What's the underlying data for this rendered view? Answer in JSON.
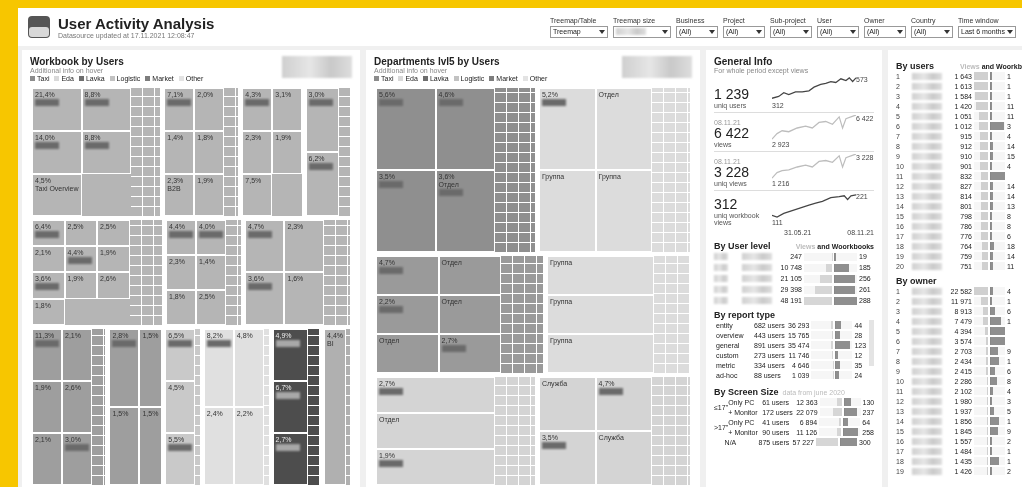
{
  "header": {
    "title": "User Activity Analysis",
    "subtitle": "Datasource updated at 17.11.2021 12:08:47",
    "filters": [
      {
        "label": "Treemap/Table",
        "value": "Treemap"
      },
      {
        "label": "Treemap size",
        "redacted": true
      },
      {
        "label": "Business",
        "value": "(All)"
      },
      {
        "label": "Project",
        "value": "(All)"
      },
      {
        "label": "Sub-project",
        "value": "(All)"
      },
      {
        "label": "User",
        "value": "(All)"
      },
      {
        "label": "Owner",
        "value": "(All)"
      },
      {
        "label": "Country",
        "value": "(All)"
      },
      {
        "label": "Time window",
        "value": "Last 6 months"
      }
    ]
  },
  "treemaps": [
    {
      "title": "Workbook by Users",
      "subtitle": "Additional info on hover",
      "legend": [
        {
          "label": "Taxi",
          "color": "#8c8c8c"
        },
        {
          "label": "Eda",
          "color": "#d9d9d9"
        },
        {
          "label": "Lavka",
          "color": "#6e6e6e"
        },
        {
          "label": "Logistic",
          "color": "#c2c2c2"
        },
        {
          "label": "Market",
          "color": "#7d7d7d"
        },
        {
          "label": "Other",
          "color": "#e3e3e3"
        }
      ],
      "bands": [
        {
          "groups": [
            {
              "color": "#b5b5b5",
              "tiles": [
                {
                  "value": "21,4%",
                  "redacted": true
                },
                {
                  "value": "8,8%",
                  "redacted": true
                },
                {
                  "value": "14,0%",
                  "redacted": true
                },
                {
                  "value": "8,8%",
                  "redacted": true
                },
                {
                  "value": "4,5%",
                  "name": "Taxi Overview"
                }
              ]
            },
            {
              "color": "#b5b5b5",
              "tiles": [
                {
                  "value": "7,1%",
                  "redacted": true
                },
                {
                  "value": "2,0%"
                },
                {
                  "value": "1,4%"
                },
                {
                  "value": "1,8%"
                },
                {
                  "value": "2,3%",
                  "name": "B2B"
                },
                {
                  "value": "1,9%"
                }
              ]
            },
            {
              "color": "#b5b5b5",
              "tiles": [
                {
                  "value": "4,3%",
                  "redacted": true
                },
                {
                  "value": "3,1%"
                },
                {
                  "value": "2,3%"
                },
                {
                  "value": "1,9%"
                },
                {
                  "value": "7,5%"
                }
              ]
            },
            {
              "color": "#b5b5b5",
              "tiles": [
                {
                  "value": "3,0%",
                  "redacted": true
                },
                {
                  "value": "6,2%",
                  "redacted": true
                }
              ]
            }
          ]
        },
        {
          "groups": [
            {
              "color": "#b5b5b5",
              "tiles": [
                {
                  "value": "6,4%",
                  "redacted": true
                },
                {
                  "value": "2,5%"
                },
                {
                  "value": "2,5%"
                },
                {
                  "value": "2,1%"
                },
                {
                  "value": "4,4%",
                  "redacted": true
                },
                {
                  "value": "1,9%"
                },
                {
                  "value": "3,6%",
                  "redacted": true
                },
                {
                  "value": "1,9%"
                },
                {
                  "value": "2,6%"
                },
                {
                  "value": "1,8%"
                }
              ]
            },
            {
              "color": "#b5b5b5",
              "tiles": [
                {
                  "value": "4,4%",
                  "redacted": true
                },
                {
                  "value": "4,0%",
                  "redacted": true
                },
                {
                  "value": "2,3%"
                },
                {
                  "value": "1,4%"
                },
                {
                  "value": "1,8%"
                },
                {
                  "value": "2,5%"
                }
              ]
            },
            {
              "color": "#b5b5b5",
              "tiles": [
                {
                  "value": "4,7%",
                  "redacted": true
                },
                {
                  "value": "2,3%"
                },
                {
                  "value": "3,6%",
                  "redacted": true
                },
                {
                  "value": "1,6%"
                }
              ]
            }
          ]
        },
        {
          "groups": [
            {
              "color": "#9e9e9e",
              "tiles": [
                {
                  "value": "11,3%",
                  "redacted": true
                },
                {
                  "value": "2,1%"
                },
                {
                  "value": "1,9%"
                },
                {
                  "value": "2,6%"
                },
                {
                  "value": "2,1%"
                },
                {
                  "value": "3,0%",
                  "redacted": true
                }
              ]
            },
            {
              "color": "#9e9e9e",
              "tiles": [
                {
                  "value": "2,8%",
                  "redacted": true
                },
                {
                  "value": "1,5%"
                },
                {
                  "value": "1,5%"
                },
                {
                  "value": "1,5%"
                }
              ]
            },
            {
              "color": "#c9c9c9",
              "tiles": [
                {
                  "value": "6,5%",
                  "redacted": true
                },
                {
                  "value": "4,5%"
                },
                {
                  "value": "5,5%",
                  "redacted": true
                }
              ]
            },
            {
              "color": "#e0e0e0",
              "tiles": [
                {
                  "value": "8,2%",
                  "redacted": true
                },
                {
                  "value": "4,8%"
                },
                {
                  "value": "2,4%"
                },
                {
                  "value": "2,2%"
                }
              ]
            },
            {
              "color": "#4d4d4d",
              "tiles": [
                {
                  "value": "4,9%",
                  "redacted": true
                },
                {
                  "value": "6,7%",
                  "redacted": true
                },
                {
                  "value": "2,7%",
                  "redacted": true
                }
              ]
            },
            {
              "color": "#b0b0b0",
              "tiles": [
                {
                  "value": "4,4%",
                  "name": "BI"
                }
              ]
            }
          ]
        }
      ]
    },
    {
      "title": "Departments lvl5 by Users",
      "subtitle": "Additional info on hover",
      "legend": [
        {
          "label": "Taxi",
          "color": "#8c8c8c"
        },
        {
          "label": "Eda",
          "color": "#d9d9d9"
        },
        {
          "label": "Lavka",
          "color": "#6e6e6e"
        },
        {
          "label": "Logistic",
          "color": "#c2c2c2"
        },
        {
          "label": "Market",
          "color": "#7d7d7d"
        },
        {
          "label": "Other",
          "color": "#e3e3e3"
        }
      ],
      "bands": [
        {
          "groups": [
            {
              "color": "#8f8f8f",
              "tiles": [
                {
                  "value": "5,6%",
                  "redacted": true
                },
                {
                  "value": "4,6%",
                  "redacted": true
                },
                {
                  "value": "3,5%",
                  "redacted": true
                },
                {
                  "value": "3,6%",
                  "name": "Отдел",
                  "redacted": true
                }
              ]
            },
            {
              "color": "#dcdcdc",
              "tiles": [
                {
                  "value": "5,2%",
                  "redacted": true
                },
                {
                  "name": "Отдел"
                },
                {
                  "name": "Группа"
                },
                {
                  "name": "Группа"
                }
              ]
            }
          ]
        },
        {
          "groups": [
            {
              "color": "#9a9a9a",
              "tiles": [
                {
                  "value": "4,7%",
                  "redacted": true
                },
                {
                  "name": "Отдел"
                },
                {
                  "value": "2,2%",
                  "redacted": true
                },
                {
                  "name": "Отдел"
                },
                {
                  "name": "Отдел"
                },
                {
                  "value": "2,7%",
                  "redacted": true
                }
              ]
            },
            {
              "color": "#dcdcdc",
              "tiles": [
                {
                  "name": "Группа"
                },
                {
                  "name": "Группа"
                },
                {
                  "name": "Группа"
                }
              ]
            }
          ]
        },
        {
          "groups": [
            {
              "color": "#d4d4d4",
              "tiles": [
                {
                  "value": "2,7%",
                  "redacted": true
                },
                {
                  "name": "Отдел"
                },
                {
                  "value": "1,9%",
                  "redacted": true
                }
              ]
            },
            {
              "color": "#d4d4d4",
              "tiles": [
                {
                  "name": "Служба"
                },
                {
                  "value": "4,7%",
                  "redacted": true
                },
                {
                  "value": "3,5%",
                  "redacted": true
                },
                {
                  "name": "Служба"
                }
              ]
            }
          ]
        }
      ]
    }
  ],
  "general_info": {
    "title": "General Info",
    "subtitle": "For whole period except views",
    "metrics": [
      {
        "value": "1 239",
        "label": "uniq users",
        "start": "312",
        "end": "573",
        "color": "#444444"
      },
      {
        "date": "08.11.21",
        "value": "6 422",
        "label": "views",
        "start": "2 923",
        "end": "6 422",
        "color": "#bdbdbd"
      },
      {
        "date": "08.11.21",
        "value": "3 228",
        "label": "uniq views",
        "start": "1 216",
        "end": "3 228",
        "color": "#bdbdbd"
      },
      {
        "value": "312",
        "label": "uniq workbook views",
        "start": "111",
        "end": "221",
        "color": "#444444"
      }
    ],
    "axis": [
      "31.05.21",
      "08.11.21"
    ]
  },
  "user_level": {
    "title": "By User level",
    "header_views": "Views",
    "header_rest": "and Woorkbooks",
    "rows": [
      {
        "views": "247",
        "views_bar": {
          "level": 0.01
        },
        "workbooks": "19",
        "workbooks_bar": {
          "level": 0.02
        }
      },
      {
        "views": "10 748",
        "views_bar": {
          "level": 0.22
        },
        "workbooks": "185",
        "workbooks_bar": {
          "level": 0.64
        }
      },
      {
        "views": "21 105",
        "views_bar": {
          "level": 0.44
        },
        "workbooks": "256",
        "workbooks_bar": {
          "level": 0.89
        }
      },
      {
        "views": "29 398",
        "views_bar": {
          "level": 0.61
        },
        "workbooks": "261",
        "workbooks_bar": {
          "level": 0.91
        }
      },
      {
        "views": "48 191",
        "views_bar": {
          "level": 1
        },
        "workbooks": "288",
        "workbooks_bar": {
          "level": 1
        }
      }
    ]
  },
  "report_type": {
    "title": "By report type",
    "rows": [
      {
        "type": "entity",
        "users": "682 users",
        "views": "36 293",
        "views_bar": {
          "level": 0.12
        },
        "workbooks": "44",
        "workbooks_bar": {
          "level": 0.3
        }
      },
      {
        "type": "overview",
        "users": "443 users",
        "views": "15 765",
        "views_bar": {
          "level": 0.06
        },
        "workbooks": "28",
        "workbooks_bar": {
          "level": 0.2
        }
      },
      {
        "type": "general",
        "users": "891 users",
        "views": "35 474",
        "views_bar": {
          "level": 0.12
        },
        "workbooks": "123",
        "workbooks_bar": {
          "level": 0.85
        }
      },
      {
        "type": "custom",
        "users": "273 users",
        "views": "11 746",
        "views_bar": {
          "level": 0.05
        },
        "workbooks": "12",
        "workbooks_bar": {
          "level": 0.08
        }
      },
      {
        "type": "metric",
        "users": "334 users",
        "views": "4 646",
        "views_bar": {
          "level": 0.02
        },
        "workbooks": "35",
        "workbooks_bar": {
          "level": 0.24
        }
      },
      {
        "type": "ad-hoc",
        "users": "88 users",
        "views": "1 039",
        "views_bar": {
          "level": 0.01
        },
        "workbooks": "24",
        "workbooks_bar": {
          "level": 0.17
        }
      }
    ]
  },
  "screen_size": {
    "title": "By Screen Size",
    "note": "data from june 2020",
    "groups": [
      {
        "label": "≤17\"",
        "rows": [
          {
            "type": "Only PC",
            "users": "61 users",
            "views": "12 363",
            "views_bar": {
              "level": 0.2
            },
            "workbooks": "130",
            "workbooks_bar": {
              "level": 0.43
            }
          },
          {
            "type": "+ Monitor",
            "users": "172 users",
            "views": "22 079",
            "views_bar": {
              "level": 0.38
            },
            "workbooks": "237",
            "workbooks_bar": {
              "level": 0.79
            }
          }
        ]
      },
      {
        "label": ">17\"",
        "rows": [
          {
            "type": "Only PC",
            "users": "41 users",
            "views": "6 894",
            "views_bar": {
              "level": 0.12
            },
            "workbooks": "64",
            "workbooks_bar": {
              "level": 0.21
            }
          },
          {
            "type": "+ Monitor",
            "users": "90 users",
            "views": "11 126",
            "views_bar": {
              "level": 0.19
            },
            "workbooks": "258",
            "workbooks_bar": {
              "level": 0.86
            }
          }
        ]
      },
      {
        "rows": [
          {
            "type": "N/A",
            "users": "875 users",
            "views": "57 227",
            "views_bar": {
              "level": 1
            },
            "workbooks": "300",
            "workbooks_bar": {
              "level": 1
            }
          }
        ]
      }
    ]
  },
  "by_users": {
    "title": "By users",
    "header_views": "Views",
    "header_rest": "and Woorkb",
    "rows": [
      {
        "rank": "1",
        "views": "1 643",
        "views_bar": {
          "level": 1
        },
        "workbooks": "1",
        "workbooks_bar": {
          "level": 0.03
        }
      },
      {
        "rank": "2",
        "views": "1 613",
        "views_bar": {
          "level": 0.98
        },
        "workbooks": "1",
        "workbooks_bar": {
          "level": 0.03
        }
      },
      {
        "rank": "3",
        "views": "1 584",
        "views_bar": {
          "level": 0.96
        },
        "workbooks": "1",
        "workbooks_bar": {
          "level": 0.03
        }
      },
      {
        "rank": "4",
        "views": "1 420",
        "views_bar": {
          "level": 0.86
        },
        "workbooks": "11",
        "workbooks_bar": {
          "level": 0.1
        }
      },
      {
        "rank": "5",
        "views": "1 051",
        "views_bar": {
          "level": 0.64
        },
        "workbooks": "11",
        "workbooks_bar": {
          "level": 0.1
        }
      },
      {
        "rank": "6",
        "views": "1 012",
        "views_bar": {
          "level": 0.62
        },
        "workbooks": "3",
        "workbooks_bar": {
          "level": 0.9
        }
      },
      {
        "rank": "7",
        "views": "915",
        "views_bar": {
          "level": 0.56
        },
        "workbooks": "4",
        "workbooks_bar": {
          "level": 0.05
        }
      },
      {
        "rank": "8",
        "views": "912",
        "views_bar": {
          "level": 0.56
        },
        "workbooks": "14",
        "workbooks_bar": {
          "level": 0.15
        }
      },
      {
        "rank": "9",
        "views": "910",
        "views_bar": {
          "level": 0.55
        },
        "workbooks": "15",
        "workbooks_bar": {
          "level": 0.16
        }
      },
      {
        "rank": "10",
        "views": "901",
        "views_bar": {
          "level": 0.55
        },
        "workbooks": "4",
        "workbooks_bar": {
          "level": 0.05
        }
      },
      {
        "rank": "11",
        "views": "832",
        "views_bar": {
          "level": 0.51
        },
        "workbooks_bar": {
          "level": 1
        }
      },
      {
        "rank": "12",
        "views": "827",
        "views_bar": {
          "level": 0.5
        },
        "workbooks": "14",
        "workbooks_bar": {
          "level": 0.15
        }
      },
      {
        "rank": "13",
        "views": "814",
        "views_bar": {
          "level": 0.5
        },
        "workbooks": "14",
        "workbooks_bar": {
          "level": 0.15
        }
      },
      {
        "rank": "14",
        "views": "801",
        "views_bar": {
          "level": 0.49
        },
        "workbooks": "13",
        "workbooks_bar": {
          "level": 0.14
        }
      },
      {
        "rank": "15",
        "views": "798",
        "views_bar": {
          "level": 0.49
        },
        "workbooks": "8",
        "workbooks_bar": {
          "level": 0.08
        }
      },
      {
        "rank": "16",
        "views": "786",
        "views_bar": {
          "level": 0.48
        },
        "workbooks": "8",
        "workbooks_bar": {
          "level": 0.08
        }
      },
      {
        "rank": "17",
        "views": "776",
        "views_bar": {
          "level": 0.47
        },
        "workbooks": "6",
        "workbooks_bar": {
          "level": 0.06
        }
      },
      {
        "rank": "18",
        "views": "764",
        "views_bar": {
          "level": 0.46
        },
        "workbooks": "18",
        "workbooks_bar": {
          "level": 0.2
        }
      },
      {
        "rank": "19",
        "views": "759",
        "views_bar": {
          "level": 0.46
        },
        "workbooks": "14",
        "workbooks_bar": {
          "level": 0.15
        }
      },
      {
        "rank": "20",
        "views": "751",
        "views_bar": {
          "level": 0.46
        },
        "workbooks": "11",
        "workbooks_bar": {
          "level": 0.12
        }
      }
    ]
  },
  "by_owner": {
    "title": "By owner",
    "rows": [
      {
        "rank": "1",
        "views": "22 582",
        "views_bar": {
          "level": 1
        },
        "workbooks": "4",
        "workbooks_bar": {
          "level": 0.15
        }
      },
      {
        "rank": "2",
        "views": "11 971",
        "views_bar": {
          "level": 0.53
        },
        "workbooks": "1",
        "workbooks_bar": {
          "level": 0.05
        }
      },
      {
        "rank": "3",
        "views": "8 913",
        "views_bar": {
          "level": 0.39
        },
        "workbooks": "6",
        "workbooks_bar": {
          "level": 0.25
        }
      },
      {
        "rank": "4",
        "views": "7 479",
        "views_bar": {
          "level": 0.33
        },
        "workbooks": "1",
        "workbooks_bar": {
          "level": 0.7
        }
      },
      {
        "rank": "5",
        "views": "4 394",
        "views_bar": {
          "level": 0.19
        },
        "workbooks_bar": {
          "level": 1
        }
      },
      {
        "rank": "6",
        "views": "3 574",
        "views_bar": {
          "level": 0.16
        },
        "workbooks_bar": {
          "level": 1
        }
      },
      {
        "rank": "7",
        "views": "2 703",
        "views_bar": {
          "level": 0.12
        },
        "workbooks": "9",
        "workbooks_bar": {
          "level": 0.5
        }
      },
      {
        "rank": "8",
        "views": "2 434",
        "views_bar": {
          "level": 0.11
        },
        "workbooks": "1",
        "workbooks_bar": {
          "level": 0.55
        }
      },
      {
        "rank": "9",
        "views": "2 415",
        "views_bar": {
          "level": 0.11
        },
        "workbooks": "6",
        "workbooks_bar": {
          "level": 0.3
        }
      },
      {
        "rank": "10",
        "views": "2 286",
        "views_bar": {
          "level": 0.1
        },
        "workbooks": "8",
        "workbooks_bar": {
          "level": 0.4
        }
      },
      {
        "rank": "11",
        "views": "2 102",
        "views_bar": {
          "level": 0.09
        },
        "workbooks": "4",
        "workbooks_bar": {
          "level": 0.15
        }
      },
      {
        "rank": "12",
        "views": "1 980",
        "views_bar": {
          "level": 0.09
        },
        "workbooks": "3",
        "workbooks_bar": {
          "level": 0.1
        }
      },
      {
        "rank": "13",
        "views": "1 937",
        "views_bar": {
          "level": 0.09
        },
        "workbooks": "5",
        "workbooks_bar": {
          "level": 0.2
        }
      },
      {
        "rank": "14",
        "views": "1 856",
        "views_bar": {
          "level": 0.08
        },
        "workbooks": "1",
        "workbooks_bar": {
          "level": 0.6
        }
      },
      {
        "rank": "15",
        "views": "1 845",
        "views_bar": {
          "level": 0.08
        },
        "workbooks": "9",
        "workbooks_bar": {
          "level": 0.5
        }
      },
      {
        "rank": "16",
        "views": "1 557",
        "views_bar": {
          "level": 0.07
        },
        "workbooks": "2",
        "workbooks_bar": {
          "level": 0.08
        }
      },
      {
        "rank": "17",
        "views": "1 484",
        "views_bar": {
          "level": 0.07
        },
        "workbooks": "1",
        "workbooks_bar": {
          "level": 0.05
        }
      },
      {
        "rank": "18",
        "views": "1 435",
        "views_bar": {
          "level": 0.06
        },
        "workbooks": "1",
        "workbooks_bar": {
          "level": 0.55
        }
      },
      {
        "rank": "19",
        "views": "1 426",
        "views_bar": {
          "level": 0.06
        },
        "workbooks": "2",
        "workbooks_bar": {
          "level": 0.08
        }
      }
    ]
  }
}
